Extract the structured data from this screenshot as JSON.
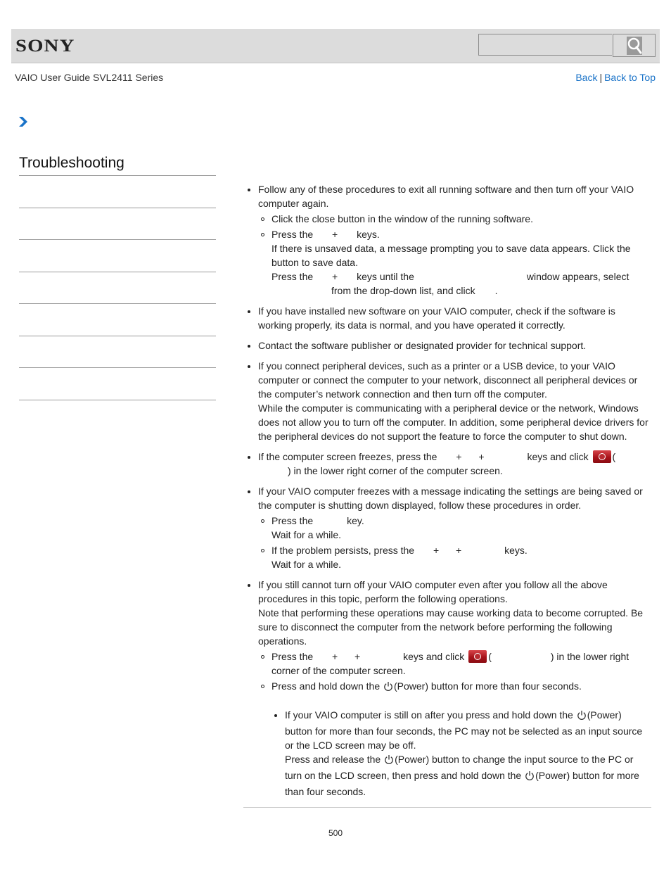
{
  "header": {
    "logo": "SONY",
    "search": {
      "value": "",
      "placeholder": ""
    },
    "search_icon": "magnifier-icon"
  },
  "subheader": {
    "guide_title": "VAIO User Guide SVL2411 Series",
    "back_label": "Back",
    "separator": "|",
    "back_to_top_label": "Back to Top"
  },
  "breadcrumb": {
    "icon": "chevron-right-icon"
  },
  "sidebar": {
    "title": "Troubleshooting",
    "items": [
      {
        "label": ""
      },
      {
        "label": ""
      },
      {
        "label": ""
      },
      {
        "label": ""
      },
      {
        "label": ""
      },
      {
        "label": ""
      },
      {
        "label": ""
      }
    ]
  },
  "content": {
    "b1": {
      "text1": "Follow any of these procedures to exit all running software and then turn off your VAIO computer again.",
      "s1": "Click the close button in the window of the running software.",
      "s2_a": "Press the",
      "s2_plus": "+",
      "s2_b": "keys.",
      "s2_line2": "If there is unsaved data, a message prompting you to save data appears. Click the",
      "s2_line3": "button to save data.",
      "s2_line4_a": "Press the",
      "s2_line4_plus": "+",
      "s2_line4_b": "keys until the",
      "s2_line4_c": "window appears, select",
      "s2_line5_a": "from the drop-down list, and click",
      "s2_line5_b": "."
    },
    "b2": "If you have installed new software on your VAIO computer, check if the software is working properly, its data is normal, and you have operated it correctly.",
    "b3": "Contact the software publisher or designated provider for technical support.",
    "b4": {
      "p1": "If you connect peripheral devices, such as a printer or a USB device, to your VAIO computer or connect the computer to your network, disconnect all peripheral devices or the computer’s network connection and then turn off the computer.",
      "p2": "While the computer is communicating with a peripheral device or the network, Windows does not allow you to turn off the computer. In addition, some peripheral device drivers for the peripheral devices do not support the feature to force the computer to shut down."
    },
    "b5": {
      "a": "If the computer screen freezes, press the",
      "plus": "+",
      "b": "keys and click",
      "c": "(",
      "d": ") in the lower right corner of the computer screen."
    },
    "b6": {
      "text": "If your VAIO computer freezes with a message indicating the settings are being saved or the computer is shutting down displayed, follow these procedures in order.",
      "s1_a": "Press the",
      "s1_b": "key.",
      "s1_c": "Wait for a while.",
      "s2_a": "If the problem persists, press the",
      "plus": "+",
      "s2_b": "keys.",
      "s2_c": "Wait for a while."
    },
    "b7": {
      "p1": "If you still cannot turn off your VAIO computer even after you follow all the above procedures in this topic, perform the following operations.",
      "p2": "Note that performing these operations may cause working data to become corrupted. Be sure to disconnect the computer from the network before performing the following operations.",
      "s1_a": "Press the",
      "plus": "+",
      "s1_b": "keys and click",
      "s1_c": "(",
      "s1_d": ") in the lower right corner of the computer screen.",
      "s2_a": "Press and hold down the",
      "s2_b": "(Power) button for more than four seconds.",
      "n1_a": "If your VAIO computer is still on after you press and hold down the",
      "n1_b": "(Power) button for more than four seconds, the PC may not be selected as an input source or the LCD screen may be off.",
      "n1_c": "Press and release the",
      "n1_d": "(Power) button to change the input source to the PC or turn on the LCD screen, then press and hold down the",
      "n1_e": "(Power) button for more than four seconds."
    }
  },
  "footer": {
    "page_number": "500"
  },
  "colors": {
    "link": "#1a73c8",
    "header_bg": "#dcdcdc",
    "accent_arrow": "#1a73c8",
    "shutdown_red": "#a8141b"
  }
}
